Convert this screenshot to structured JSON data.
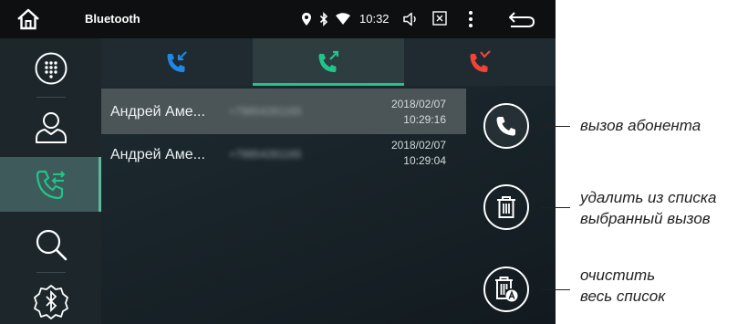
{
  "status_bar": {
    "title": "Bluetooth",
    "time": "10:32",
    "icons": [
      "home-icon",
      "location-icon",
      "bluetooth-icon",
      "wifi-icon",
      "volume-icon",
      "screen-icon",
      "menu-icon",
      "back-icon"
    ]
  },
  "sidebar": {
    "items": [
      {
        "name": "dialpad",
        "icon": "dialpad-icon",
        "active": false
      },
      {
        "name": "contacts",
        "icon": "contact-icon",
        "active": false
      },
      {
        "name": "call-log",
        "icon": "call-log-icon",
        "active": true
      },
      {
        "name": "search",
        "icon": "search-icon",
        "active": false
      },
      {
        "name": "bluetooth-settings",
        "icon": "bluetooth-settings-icon",
        "active": false
      }
    ]
  },
  "tabs": [
    {
      "name": "incoming",
      "icon": "incoming-call-icon",
      "color": "#1e88e5",
      "active": false
    },
    {
      "name": "outgoing",
      "icon": "outgoing-call-icon",
      "color": "#22c48a",
      "active": true
    },
    {
      "name": "missed",
      "icon": "missed-call-icon",
      "color": "#f44336",
      "active": false
    }
  ],
  "calls": [
    {
      "name": "Андрей Аме...",
      "number": "+79854281165",
      "date": "2018/02/07",
      "time": "10:29:16",
      "selected": true
    },
    {
      "name": "Андрей Аме...",
      "number": "+79854281165",
      "date": "2018/02/07",
      "time": "10:29:04",
      "selected": false
    }
  ],
  "actions": {
    "call": {
      "icon": "phone-icon"
    },
    "delete": {
      "icon": "trash-icon"
    },
    "clear_all": {
      "icon": "trash-all-icon"
    }
  },
  "callouts": {
    "call": "вызов абонента",
    "delete_line1": "удалить из списка",
    "delete_line2": "выбранный вызов",
    "clear_line1": "очистить",
    "clear_line2": "весь список"
  },
  "colors": {
    "accent_green": "#22c48a",
    "incoming_blue": "#1e88e5",
    "missed_red": "#f44336"
  }
}
